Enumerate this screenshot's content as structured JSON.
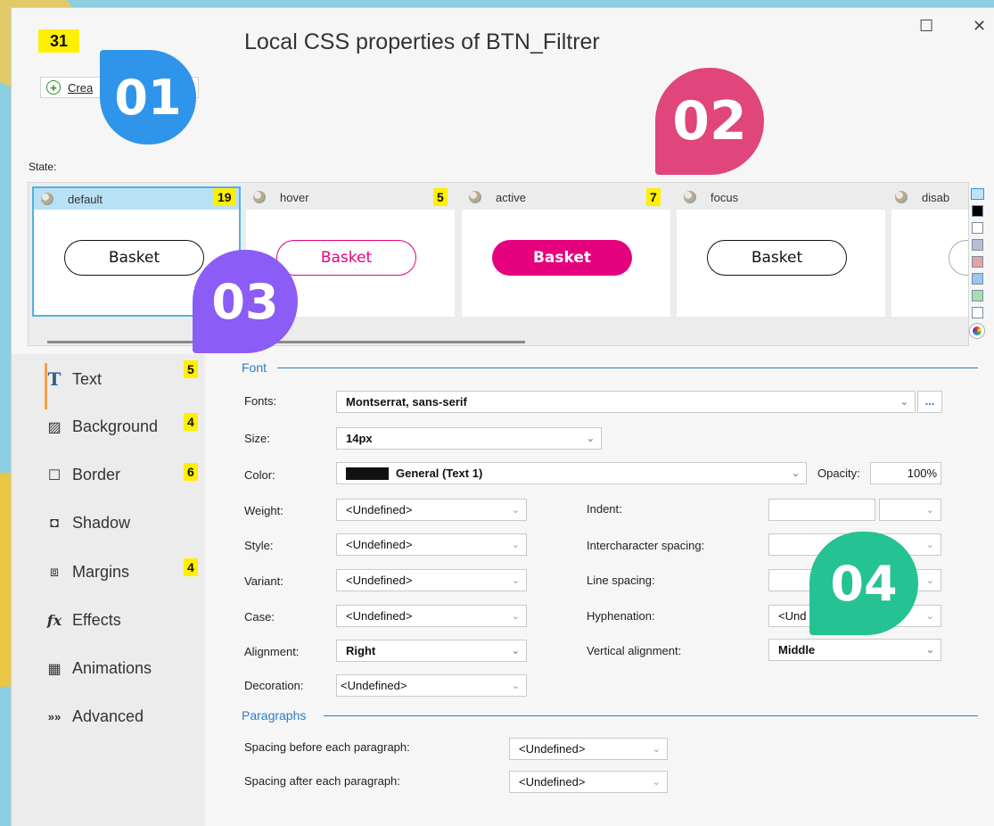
{
  "window": {
    "title": "Local CSS properties of BTN_Filtrer",
    "maximize_glyph": "☐",
    "close_glyph": "✕"
  },
  "badges": {
    "top_count": "31",
    "default": "19",
    "hover": "5",
    "active": "7",
    "text": "5",
    "background": "4",
    "border": "6",
    "margins": "4"
  },
  "callouts": {
    "c01": "01",
    "c02": "02",
    "c03": "03",
    "c04": "04"
  },
  "toolbar": {
    "create_label": "Crea"
  },
  "states": {
    "label": "State:",
    "items": [
      {
        "name": "default",
        "button": "Basket"
      },
      {
        "name": "hover",
        "button": "Basket"
      },
      {
        "name": "active",
        "button": "Basket"
      },
      {
        "name": "focus",
        "button": "Basket"
      },
      {
        "name": "disab"
      }
    ]
  },
  "sidebar": {
    "items": [
      {
        "label": "Text",
        "icon": "T"
      },
      {
        "label": "Background",
        "icon": "▨"
      },
      {
        "label": "Border",
        "icon": "☐"
      },
      {
        "label": "Shadow",
        "icon": "◘"
      },
      {
        "label": "Margins",
        "icon": "⧈"
      },
      {
        "label": "Effects",
        "icon": "fx"
      },
      {
        "label": "Animations",
        "icon": "▦"
      },
      {
        "label": "Advanced",
        "icon": "»»"
      }
    ]
  },
  "font": {
    "section": "Font",
    "fonts_label": "Fonts:",
    "fonts_value": "Montserrat, sans-serif",
    "dots": "...",
    "size_label": "Size:",
    "size_value": "14px",
    "color_label": "Color:",
    "color_value": "General (Text 1)",
    "opacity_label": "Opacity:",
    "opacity_value": "100%",
    "weight_label": "Weight:",
    "weight_value": "<Undefined>",
    "style_label": "Style:",
    "style_value": "<Undefined>",
    "variant_label": "Variant:",
    "variant_value": "<Undefined>",
    "case_label": "Case:",
    "case_value": "<Undefined>",
    "alignment_label": "Alignment:",
    "alignment_value": "Right",
    "decoration_label": "Decoration:",
    "decoration_value": "<Undefined>",
    "indent_label": "Indent:",
    "interchar_label": "Intercharacter spacing:",
    "linespacing_label": "Line spacing:",
    "hyphenation_label": "Hyphenation:",
    "hyphenation_value": "<Und",
    "valign_label": "Vertical alignment:",
    "valign_value": "Middle"
  },
  "paragraphs": {
    "section": "Paragraphs",
    "before_label": "Spacing before each paragraph:",
    "before_value": "<Undefined>",
    "after_label": "Spacing after each paragraph:",
    "after_value": "<Undefined>"
  },
  "colors": {
    "accent_pink": "#e5007e",
    "callout_blue": "#2f95ea",
    "callout_pink": "#e0457b",
    "callout_purple": "#8b5cf6",
    "callout_green": "#25c293",
    "section_blue": "#2f7bc2",
    "selected_state": "#b9e1f5"
  }
}
